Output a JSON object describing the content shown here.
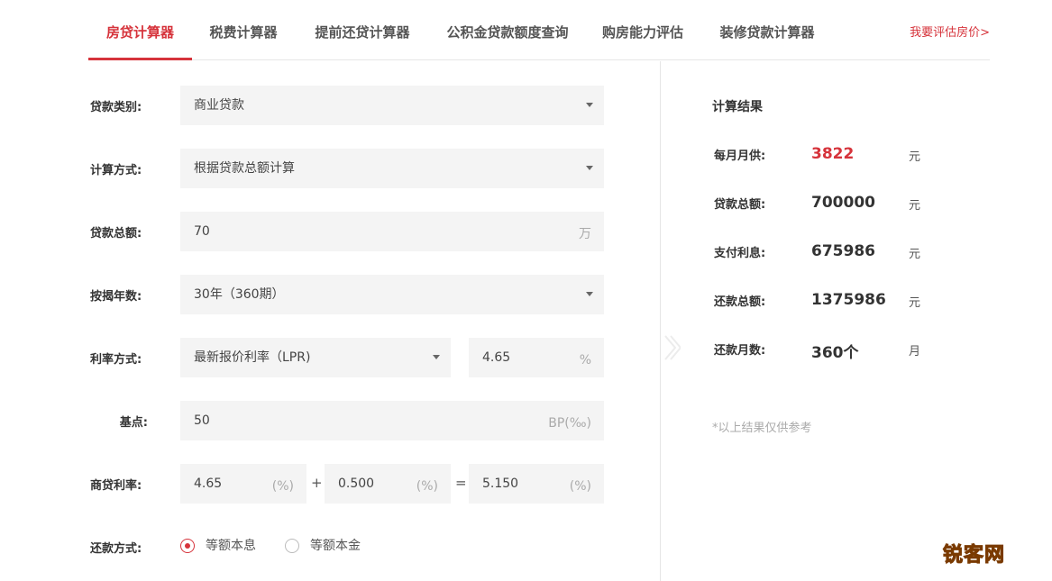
{
  "tabs": {
    "items": [
      {
        "label": "房贷计算器",
        "active": true
      },
      {
        "label": "税费计算器",
        "active": false
      },
      {
        "label": "提前还贷计算器",
        "active": false
      },
      {
        "label": "公积金贷款额度查询",
        "active": false
      },
      {
        "label": "购房能力评估",
        "active": false
      },
      {
        "label": "装修贷款计算器",
        "active": false
      }
    ],
    "link": "我要评估房价>"
  },
  "form": {
    "loan_type": {
      "label": "贷款类别:",
      "value": "商业贷款"
    },
    "calc_method": {
      "label": "计算方式:",
      "value": "根据贷款总额计算"
    },
    "loan_amount": {
      "label": "贷款总额:",
      "value": "70",
      "unit": "万"
    },
    "loan_years": {
      "label": "按揭年数:",
      "value": "30年（360期）"
    },
    "rate_type": {
      "label": "利率方式:",
      "value": "最新报价利率（LPR)",
      "rate": "4.65",
      "rate_unit": "%"
    },
    "basis_point": {
      "label": "基点:",
      "value": "50",
      "unit": "BP(‰)"
    },
    "commercial_rate": {
      "label": "商贷利率:",
      "base": "4.65",
      "base_unit": "(%)",
      "plus": "+",
      "added": "0.500",
      "added_unit": "(%)",
      "equals": "=",
      "result": "5.150",
      "result_unit": "(%)"
    },
    "repayment": {
      "label": "还款方式:",
      "options": [
        {
          "label": "等额本息",
          "checked": true
        },
        {
          "label": "等额本金",
          "checked": false
        }
      ]
    }
  },
  "results": {
    "title": "计算结果",
    "items": [
      {
        "label": "每月月供:",
        "value": "3822",
        "unit": "元"
      },
      {
        "label": "贷款总额:",
        "value": "700000",
        "unit": "元"
      },
      {
        "label": "支付利息:",
        "value": "675986",
        "unit": "元"
      },
      {
        "label": "还款总额:",
        "value": "1375986",
        "unit": "元"
      },
      {
        "label": "还款月数:",
        "value": "360个",
        "unit": "月"
      }
    ],
    "note": "*以上结果仅供参考"
  },
  "watermark": "锐客网",
  "colors": {
    "accent": "#d6333b",
    "field_bg": "#f4f4f4"
  }
}
